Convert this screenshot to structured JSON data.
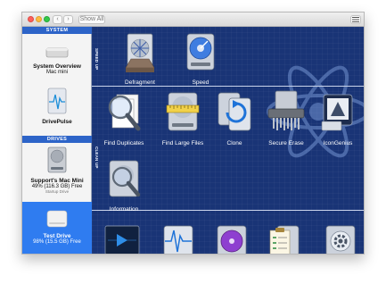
{
  "toolbar": {
    "show_all": "Show All"
  },
  "sidebar": {
    "system_header": "SYSTEM",
    "system_item": {
      "title": "System Overview",
      "subtitle": "Mac mini"
    },
    "drivepulse": {
      "title": "DrivePulse"
    },
    "drives_header": "DRIVES",
    "drive1": {
      "title": "Support's Mac Mini",
      "subtitle": "49% (116.3 GB) Free",
      "note": "Startup Drive"
    },
    "drive2": {
      "title": "Test Drive",
      "subtitle": "98% (15.5 GB) Free"
    }
  },
  "sections": {
    "speed_up": "SPEED UP",
    "clean_up": "CLEAN UP"
  },
  "tools": {
    "defragment": "Defragment",
    "speed": "Speed",
    "find_duplicates": "Find Duplicates",
    "find_large_files": "Find Large Files",
    "clone": "Clone",
    "secure_erase": "Secure Erase",
    "icongenius": "IconGenius",
    "information": "Information"
  },
  "colors": {
    "accent": "#2d64c8",
    "background": "#193476",
    "selected": "#2f7cf0"
  },
  "icons": [
    "defragment-icon",
    "speed-icon",
    "magnifier-icon",
    "ruler-icon",
    "clone-icon",
    "shredder-icon",
    "icongenius-icon",
    "information-icon",
    "monitor-icon",
    "pulse-icon",
    "disk-icon",
    "checklist-icon",
    "gear-icon"
  ]
}
